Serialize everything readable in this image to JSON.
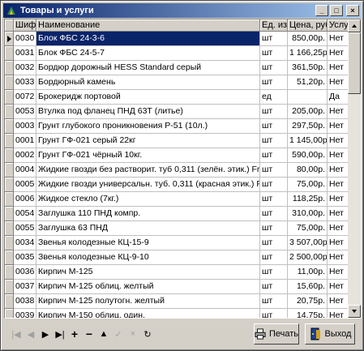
{
  "window": {
    "title": "Товары и услуги",
    "minimize": "_",
    "maximize": "□",
    "close": "×"
  },
  "columns": [
    "Шифр",
    "Наименование",
    "Ед. изм.",
    "Цена, руб",
    "Услуга"
  ],
  "rows": [
    {
      "code": "0030",
      "name": "Блок ФБС 24-3-6",
      "unit": "шт",
      "price": "850,00р.",
      "service": "Нет",
      "selected": true
    },
    {
      "code": "0031",
      "name": "Блок ФБС 24-5-7",
      "unit": "шт",
      "price": "1 166,25р.",
      "service": "Нет"
    },
    {
      "code": "0032",
      "name": "Бордюр дорожный HESS Standard серый",
      "unit": "шт",
      "price": "361,50р.",
      "service": "Нет"
    },
    {
      "code": "0033",
      "name": "Бордюрный камень",
      "unit": "шт",
      "price": "51,20р.",
      "service": "Нет"
    },
    {
      "code": "0072",
      "name": "Брокеридж портовой",
      "unit": "ед",
      "price": "",
      "service": "Да"
    },
    {
      "code": "0053",
      "name": "Втулка под фланец ПНД 63Т (литье)",
      "unit": "шт",
      "price": "205,00р.",
      "service": "Нет"
    },
    {
      "code": "0003",
      "name": "Грунт глубокого проникновения Р-51 (10л.)",
      "unit": "шт",
      "price": "297,50р.",
      "service": "Нет"
    },
    {
      "code": "0001",
      "name": "Грунт ГФ-021 серый 22кг",
      "unit": "шт",
      "price": "1 145,00р.",
      "service": "Нет"
    },
    {
      "code": "0002",
      "name": "Грунт ГФ-021 чёрный 10кг.",
      "unit": "шт",
      "price": "590,00р.",
      "service": "Нет"
    },
    {
      "code": "0004",
      "name": "Жидкие гвозди без растворит. туб 0,311 (зелён. этик.) Frankin 7",
      "unit": "шт",
      "price": "80,00р.",
      "service": "Нет"
    },
    {
      "code": "0005",
      "name": "Жидкие гвозди универсальн. туб. 0,311 (красная этик.) Frankin 7",
      "unit": "шт",
      "price": "75,00р.",
      "service": "Нет"
    },
    {
      "code": "0006",
      "name": "Жидкое стекло (7кг.)",
      "unit": "шт",
      "price": "118,25р.",
      "service": "Нет"
    },
    {
      "code": "0054",
      "name": "Заглушка 110 ПНД компр.",
      "unit": "шт",
      "price": "310,00р.",
      "service": "Нет"
    },
    {
      "code": "0055",
      "name": "Заглушка 63 ПНД",
      "unit": "шт",
      "price": "75,00р.",
      "service": "Нет"
    },
    {
      "code": "0034",
      "name": "Звенья колодезные КЦ-15-9",
      "unit": "шт",
      "price": "3 507,00р.",
      "service": "Нет"
    },
    {
      "code": "0035",
      "name": "Звенья колодезные КЦ-9-10",
      "unit": "шт",
      "price": "2 500,00р.",
      "service": "Нет"
    },
    {
      "code": "0036",
      "name": "Кирпич М-125",
      "unit": "шт",
      "price": "11,00р.",
      "service": "Нет"
    },
    {
      "code": "0037",
      "name": "Кирпич М-125 облиц. желтый",
      "unit": "шт",
      "price": "15,60р.",
      "service": "Нет"
    },
    {
      "code": "0038",
      "name": "Кирпич М-125 полутогн. желтый",
      "unit": "шт",
      "price": "20,75р.",
      "service": "Нет"
    },
    {
      "code": "0039",
      "name": "Кирпич М-150 облиц. один.",
      "unit": "шт",
      "price": "14,75р.",
      "service": "Нет"
    },
    {
      "code": "0040",
      "name": "Кирпич М-150 облиц. утолщ.",
      "unit": "шт",
      "price": "20,00р.",
      "service": "Нет"
    },
    {
      "code": "0041",
      "name": "Кирпич полут.серый фактурный",
      "unit": "шт",
      "price": "12,00р.",
      "service": "Нет"
    }
  ],
  "navigator": {
    "first": "|◀",
    "prior": "◀",
    "next": "▶",
    "last": "▶|",
    "insert": "+",
    "delete": "−",
    "edit": "▲",
    "post": "✓",
    "cancel": "×",
    "refresh": "↻"
  },
  "buttons": {
    "print": "Печать",
    "exit": "Выход"
  },
  "colors": {
    "title_start": "#0a246a",
    "title_end": "#a6caf0",
    "selection": "#0a246a",
    "face": "#d4d0c8"
  }
}
